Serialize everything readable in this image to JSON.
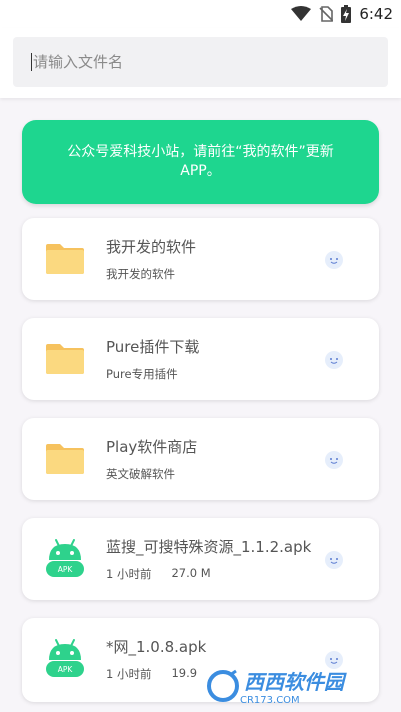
{
  "status_bar": {
    "time": "6:42"
  },
  "search": {
    "placeholder": "请输入文件名",
    "value": ""
  },
  "banner": {
    "text": "公众号爱科技小站，请前往“我的软件”更新APP。"
  },
  "items": [
    {
      "title": "我开发的软件",
      "subtitle": "我开发的软件",
      "icon": "folder-icon"
    },
    {
      "title": "Pure插件下载",
      "subtitle": "Pure专用插件",
      "icon": "folder-icon"
    },
    {
      "title": "Play软件商店",
      "subtitle": "英文破解软件",
      "icon": "folder-icon"
    },
    {
      "title": "蓝搜_可搜特殊资源_1.1.2.apk",
      "time": "1 小时前",
      "size": "27.0 M",
      "icon": "android-apk-icon",
      "badge": "APK"
    },
    {
      "title": "*网_1.0.8.apk",
      "time": "1 小时前",
      "size": "19.9",
      "icon": "android-apk-icon",
      "badge": "APK"
    }
  ],
  "watermark": {
    "brand": "西西软件园",
    "domain": "CR173.COM"
  },
  "colors": {
    "accent": "#1ed68f",
    "folder": "#f9d67a",
    "apk": "#2ed28c"
  }
}
